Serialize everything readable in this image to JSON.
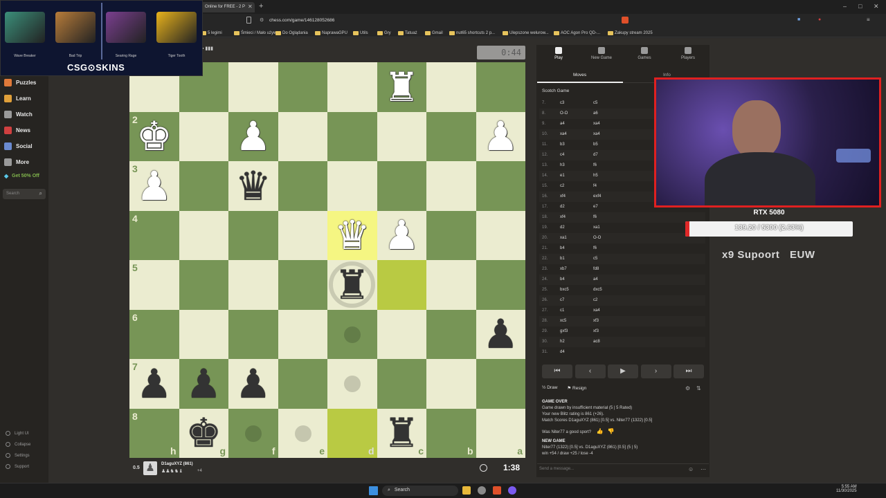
{
  "browser": {
    "tab_title": "Online for FREE - 2 P",
    "new_tab": "+",
    "url": "chess.com/game/146128052686",
    "window_controls": [
      "–",
      "□",
      "✕"
    ],
    "bookmarks": [
      "5 legimi",
      "Śmieci / Mało używ...",
      "Do Oglądania",
      "NaprawaGPU",
      "Utils",
      "Gry",
      "Tatuaż",
      "Gmail",
      "nut65 shortcuts 2 p...",
      "Ulepszone welurow...",
      "AOC Agon Pro QD-...",
      "Zakupy stream 2025"
    ]
  },
  "overlay": {
    "skins": [
      {
        "name": "Wave Breaker",
        "color": "#3b8f7a"
      },
      {
        "name": "Bad Trip",
        "color": "#b77c3a"
      },
      {
        "name": "Searing Rage",
        "color": "#7a3f8f"
      },
      {
        "name": "Tiger Tooth",
        "color": "#e8b21c"
      }
    ],
    "brand": "CSG⊙SKINS",
    "gpu_label": "RTX 5080",
    "gpu_progress": "139.20 / 5300 (2.63%)",
    "gpu_fraction": 0.0263,
    "support_line": "x9 Supoort",
    "region": "EUW"
  },
  "sidebar": {
    "items": [
      {
        "label": "Puzzles",
        "icon": "puzzle-icon",
        "color": "#e07a3a"
      },
      {
        "label": "Learn",
        "icon": "learn-icon",
        "color": "#e0a03a"
      },
      {
        "label": "Watch",
        "icon": "watch-icon",
        "color": "#9a9a9a"
      },
      {
        "label": "News",
        "icon": "news-icon",
        "color": "#d04040"
      },
      {
        "label": "Social",
        "icon": "social-icon",
        "color": "#6a8ad0"
      },
      {
        "label": "More",
        "icon": "more-icon",
        "color": "#9a9a9a"
      }
    ],
    "promo": "Get 50% Off",
    "search_placeholder": "Search",
    "footer": [
      "Light UI",
      "Collapse",
      "Settings",
      "Support"
    ]
  },
  "board": {
    "ranks": [
      "",
      "2",
      "3",
      "4",
      "5",
      "6",
      "7",
      "8"
    ],
    "files": [
      "h",
      "g",
      "f",
      "e",
      "d",
      "c",
      "b",
      "a"
    ],
    "top_clock": "0:44",
    "bottom_clock": "1:38",
    "bottom_player": "D1aguXYZ (861)",
    "bottom_score": "0.5",
    "bottom_material": "+4"
  },
  "panel": {
    "tabs": [
      "Play",
      "New Game",
      "Games",
      "Players"
    ],
    "subtabs": [
      "Moves",
      "Info"
    ],
    "opening": "Scotch Game",
    "moves": [
      {
        "n": "7.",
        "w": "c3",
        "b": "c5"
      },
      {
        "n": "8.",
        "w": "O-O",
        "b": "a6"
      },
      {
        "n": "9.",
        "w": "a4",
        "b": "xa4"
      },
      {
        "n": "10.",
        "w": "xa4",
        "b": "xa4"
      },
      {
        "n": "11.",
        "w": "b3",
        "b": "b5"
      },
      {
        "n": "12.",
        "w": "c4",
        "b": "d7"
      },
      {
        "n": "13.",
        "w": "h3",
        "b": "f6"
      },
      {
        "n": "14.",
        "w": "e1",
        "b": "h5"
      },
      {
        "n": "15.",
        "w": "c2",
        "b": "f4"
      },
      {
        "n": "16.",
        "w": "xf4",
        "b": "exf4"
      },
      {
        "n": "17.",
        "w": "d2",
        "b": "e7"
      },
      {
        "n": "18.",
        "w": "xf4",
        "b": "f6"
      },
      {
        "n": "19.",
        "w": "d2",
        "b": "xa1"
      },
      {
        "n": "20.",
        "w": "xa1",
        "b": "O-O"
      },
      {
        "n": "21.",
        "w": "b4",
        "b": "f6"
      },
      {
        "n": "22.",
        "w": "b1",
        "b": "c5"
      },
      {
        "n": "23.",
        "w": "xb7",
        "b": "fd8"
      },
      {
        "n": "24.",
        "w": "b4",
        "b": "a4"
      },
      {
        "n": "25.",
        "w": "bxc5",
        "b": "dxc5"
      },
      {
        "n": "26.",
        "w": "c7",
        "b": "c2"
      },
      {
        "n": "27.",
        "w": "c1",
        "b": "xa4"
      },
      {
        "n": "28.",
        "w": "xc5",
        "b": "xf3"
      },
      {
        "n": "29.",
        "w": "gxf3",
        "b": "xf3"
      },
      {
        "n": "30.",
        "w": "h2",
        "b": "ac8"
      },
      {
        "n": "31.",
        "w": "d4",
        "b": ""
      }
    ],
    "controls": [
      "⏮",
      "‹",
      "▶",
      "›",
      "⏭"
    ],
    "draw_label": "Draw",
    "resign_label": "Resign",
    "game_over": "GAME OVER",
    "result_line": "Game drawn by insufficient material (5 | 5 Rated)",
    "rating_line": "Your new Blitz rating is 861 (+26).",
    "match_line": "Match Scores D1aguXYZ (861) [0.5] vs. Niter77 (1322) [0.5]",
    "sport_line": "Was Niter77 a good sport?",
    "new_game": "NEW GAME",
    "new_game_line": "Niter77 (1322) [0.5] vs. D1aguXYZ (861) [0.5] (5 | 5)",
    "stats_line": "win +54 / draw +25 / lose -4",
    "message_placeholder": "Send a message..."
  },
  "taskbar": {
    "search": "Search",
    "time": "5:55 AM",
    "date": "11/30/2025"
  }
}
